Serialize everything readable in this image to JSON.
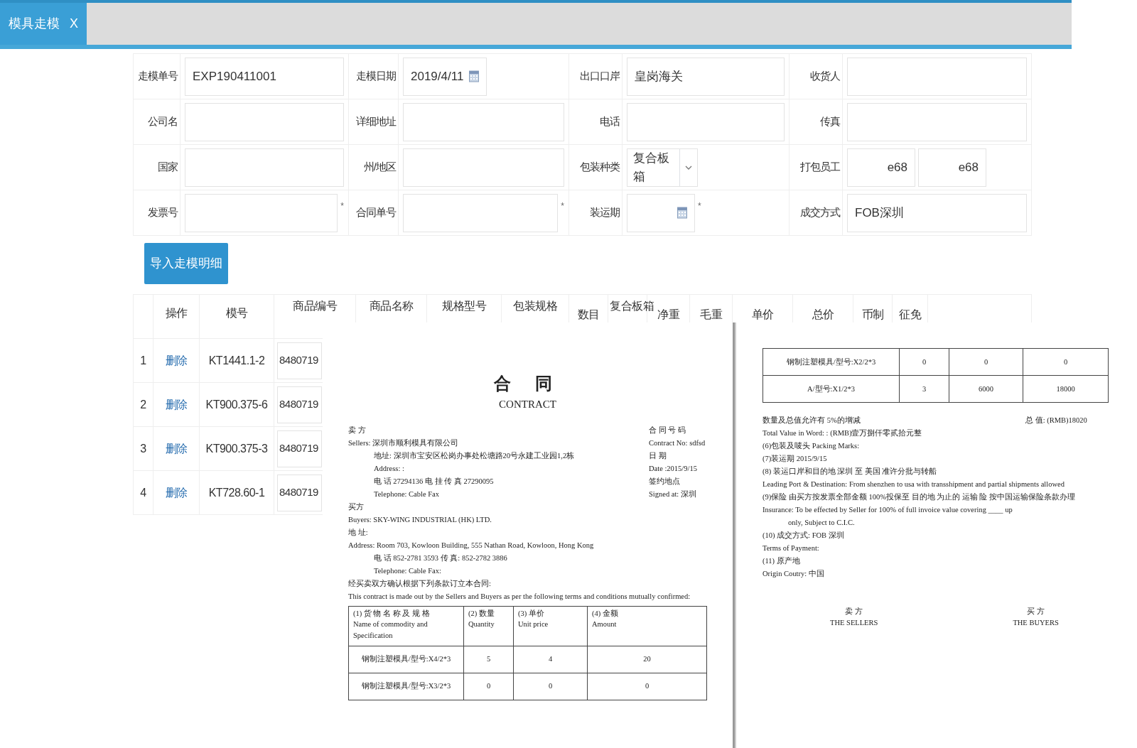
{
  "tab_bar": {
    "tabs": [
      {
        "label": "模具走模",
        "close": "X",
        "selected": true
      }
    ]
  },
  "form": {
    "rows": [
      [
        {
          "label": "走模单号",
          "kind": "text",
          "value": "EXP190411001"
        },
        {
          "label": "走模日期",
          "kind": "date",
          "value": "2019/4/11"
        },
        {
          "label": "出口口岸",
          "kind": "text",
          "value": "皇岗海关"
        },
        {
          "label": "收货人",
          "kind": "text"
        }
      ],
      [
        {
          "label": "公司名",
          "kind": "text"
        },
        {
          "label": "详细地址",
          "kind": "text"
        },
        {
          "label": "电话",
          "kind": "text"
        },
        {
          "label": "传真",
          "kind": "text"
        }
      ],
      [
        {
          "label": "国家",
          "kind": "text"
        },
        {
          "label": "州/地区",
          "kind": "text"
        },
        {
          "label": "包装种类",
          "kind": "select",
          "value": "复合板箱"
        },
        {
          "label": "打包员工",
          "kind": "pair",
          "values": [
            "e68",
            "e68"
          ]
        }
      ],
      [
        {
          "label": "发票号",
          "kind": "text",
          "suffix": "*"
        },
        {
          "label": "合同单号",
          "kind": "text",
          "suffix": "*"
        },
        {
          "label": "装运期",
          "kind": "date",
          "suffix": "*"
        },
        {
          "label": "成交方式",
          "kind": "text",
          "value": "FOB深圳"
        }
      ]
    ]
  },
  "import_button": "导入走模明细",
  "table": {
    "columns": [
      "操作",
      "模号",
      "商品编号",
      "商品名称",
      "规格型号",
      "包装规格",
      "数目",
      "复合板箱",
      "净重",
      "毛重",
      "单价",
      "总价",
      "币制",
      "征免"
    ],
    "rows": [
      {
        "index": "1",
        "action": "删除",
        "mold_no": "KT1441.1-2",
        "code": "8480719"
      },
      {
        "index": "2",
        "action": "删除",
        "mold_no": "KT900.375-6",
        "code": "8480719"
      },
      {
        "index": "3",
        "action": "删除",
        "mold_no": "KT900.375-3",
        "code": "8480719"
      },
      {
        "index": "4",
        "action": "删除",
        "mold_no": "KT728.60-1",
        "code": "8480719"
      }
    ]
  },
  "document": {
    "left_page": {
      "title": "合 同",
      "subtitle": "CONTRACT",
      "lines": [
        {
          "left": "卖 方",
          "right": "合 同 号 码"
        },
        {
          "left": "Sellers: 深圳市顺利模具有限公司",
          "right": "Contract No: sdfsd"
        },
        {
          "left": "地址: 深圳市宝安区松岗办事处松塘路20号永建工业园1,2栋",
          "right": "日 期",
          "indent": true
        },
        {
          "left": "Address: :",
          "right": "Date :2015/9/15",
          "indent": true
        },
        {
          "left": "电 话 27294136 电 挂 传 真 27290095",
          "right": "签约地点",
          "indent": true
        },
        {
          "left": "Telephone: Cable Fax",
          "right": "Signed at: 深圳",
          "indent": true
        },
        {
          "left": "买方"
        },
        {
          "left": "Buyers: SKY-WING INDUSTRIAL (HK) LTD."
        },
        {
          "left": "地 址:"
        },
        {
          "left": "Address: Room 703, Kowloon Building, 555 Nathan Road, Kowloon, Hong Kong"
        },
        {
          "left": "电 话 852-2781 3593 传 真: 852-2782 3886",
          "indent": true
        },
        {
          "left": "Telephone: Cable Fax:",
          "indent": true
        },
        {
          "left": "经买卖双方确认根据下列条款订立本合同:"
        },
        {
          "left": "This contract is made out by the Sellers and Buyers as per the following terms and conditions mutually confirmed:"
        }
      ],
      "goods_table": {
        "headers": [
          [
            "(1) 货 物 名 称 及 规 格",
            "Name of commodity and Specification"
          ],
          [
            "(2) 数量",
            "Quantity"
          ],
          [
            "(3) 单价",
            "Unit price"
          ],
          [
            "(4) 金额",
            "Amount"
          ]
        ],
        "rows": [
          [
            "钢制注塑模具/型号:X4/2*3",
            "5",
            "4",
            "20"
          ],
          [
            "钢制注塑模具/型号:X3/2*3",
            "0",
            "0",
            "0"
          ]
        ]
      }
    },
    "right_page": {
      "goods_table": {
        "rows": [
          [
            "钢制注塑模具/型号:X2/2*3",
            "0",
            "0",
            "0"
          ],
          [
            "A/型号:X1/2*3",
            "3",
            "6000",
            "18000"
          ]
        ]
      },
      "lines": [
        {
          "left": "数量及总值允许有 5%的增减",
          "right": "总 值: (RMB)18020"
        },
        {
          "left": "Total Value in Word: : (RMB)壹万捌仟零贰拾元整"
        },
        {
          "left": "(6)包装及唛头 Packing Marks:"
        },
        {
          "left": "(7)装运期 2015/9/15"
        },
        {
          "left": "(8) 装运口岸和目的地 深圳 至 美国 准许分批与转船"
        },
        {
          "left": "Leading Port & Destination: From shenzhen to usa with transshipment and partial shipments allowed"
        },
        {
          "left": "(9)保险 由买方按发票全部金额 100%投保至 目的地 为止的 运输 险 按中国运输保险条款办理"
        },
        {
          "left": "Insurance: To be effected by Seller for 100% of full invoice value covering ____ up"
        },
        {
          "left": "only, Subject to C.I.C.",
          "indent": true
        },
        {
          "left": "(10) 成交方式: FOB 深圳"
        },
        {
          "left": "Terms of Payment:"
        },
        {
          "left": "(11) 原产地"
        },
        {
          "left": "Origin Coutry: 中国"
        }
      ],
      "signatures": [
        [
          "卖 方",
          "THE SELLERS"
        ],
        [
          "买 方",
          "THE BUYERS"
        ]
      ]
    }
  }
}
